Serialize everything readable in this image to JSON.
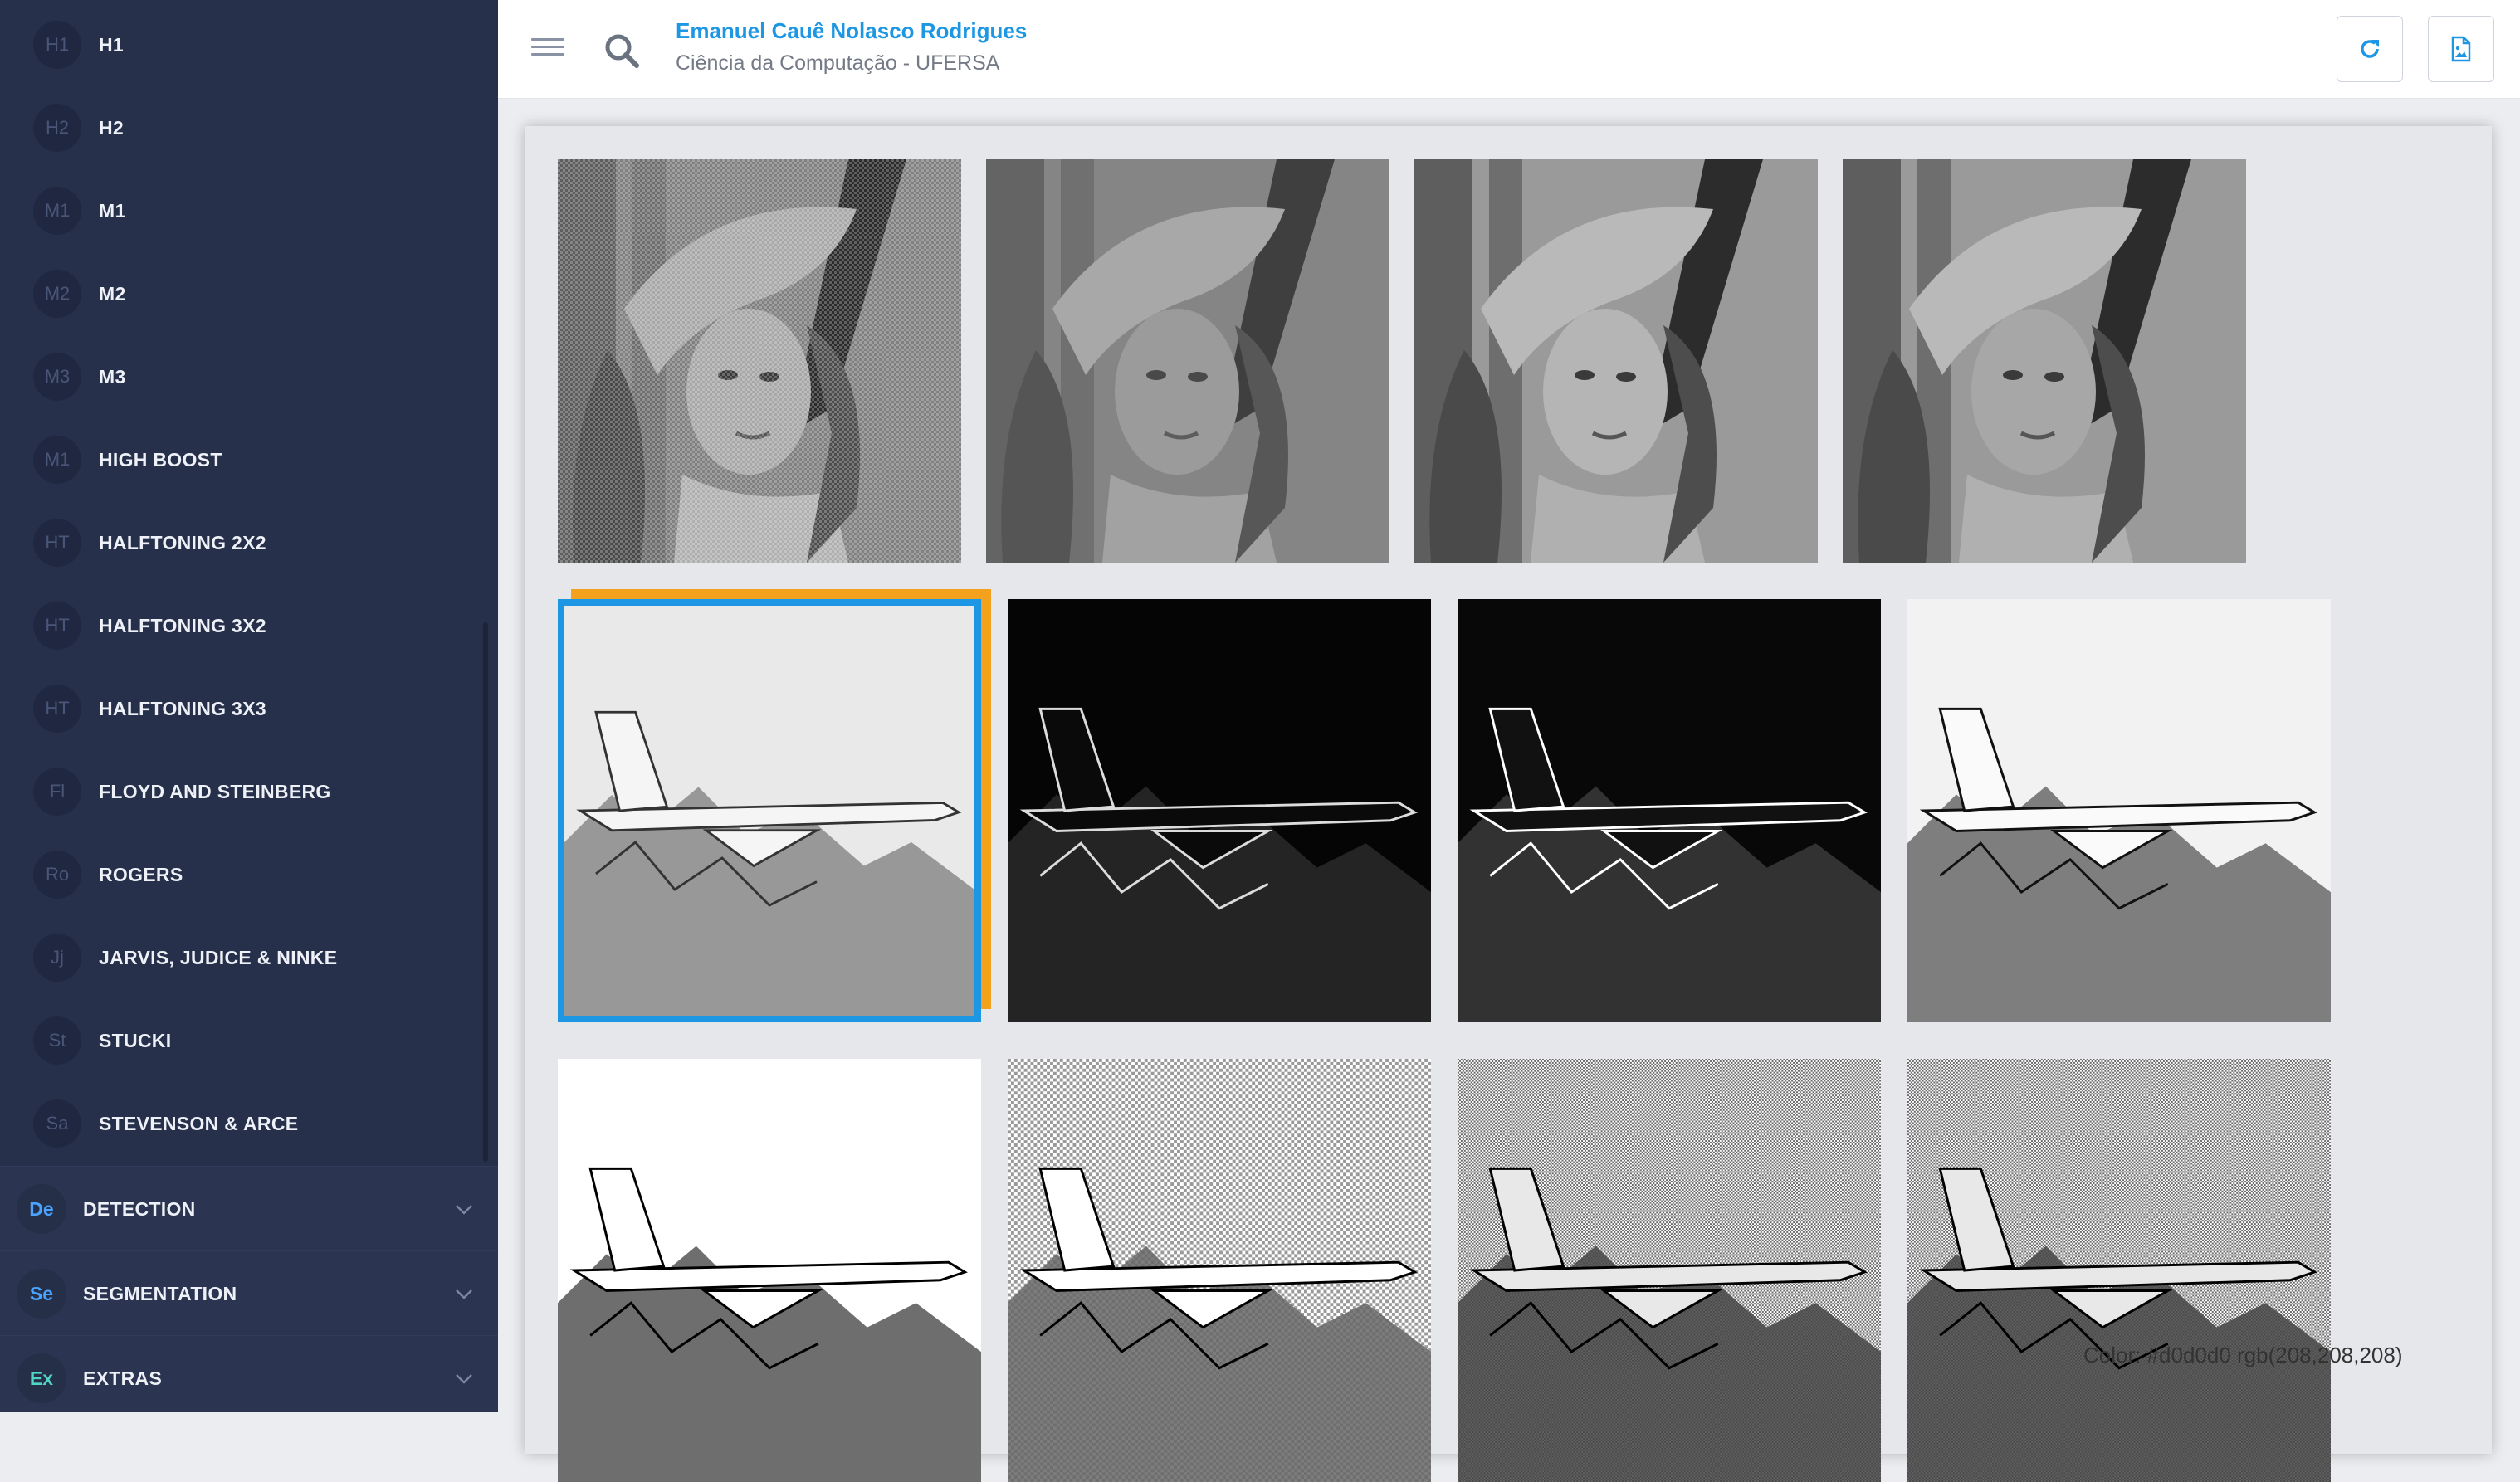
{
  "sidebar": {
    "items": [
      {
        "badge": "H1",
        "label": "H1"
      },
      {
        "badge": "H2",
        "label": "H2"
      },
      {
        "badge": "M1",
        "label": "M1"
      },
      {
        "badge": "M2",
        "label": "M2"
      },
      {
        "badge": "M3",
        "label": "M3"
      },
      {
        "badge": "M1",
        "label": "HIGH BOOST"
      },
      {
        "badge": "HT",
        "label": "HALFTONING 2X2"
      },
      {
        "badge": "HT",
        "label": "HALFTONING 3X2"
      },
      {
        "badge": "HT",
        "label": "HALFTONING 3X3"
      },
      {
        "badge": "Fl",
        "label": "FLOYD AND STEINBERG"
      },
      {
        "badge": "Ro",
        "label": "ROGERS"
      },
      {
        "badge": "Jj",
        "label": "JARVIS, JUDICE & NINKE"
      },
      {
        "badge": "St",
        "label": "STUCKI"
      },
      {
        "badge": "Sa",
        "label": "STEVENSON & ARCE"
      }
    ],
    "groups": [
      {
        "badge": "De",
        "label": "DETECTION",
        "color": "#4aa3ff"
      },
      {
        "badge": "Se",
        "label": "SEGMENTATION",
        "color": "#4aa3ff"
      },
      {
        "badge": "Ex",
        "label": "EXTRAS",
        "color": "#4fd6c4"
      }
    ]
  },
  "header": {
    "user_name": "Emanuel Cauê Nolasco Rodrigues",
    "user_subtitle": "Ciência da Computação - UFERSA",
    "icons": [
      "menu-icon",
      "search-icon",
      "refresh-icon",
      "file-image-icon"
    ],
    "accent": "#1d97e3"
  },
  "gallery": {
    "rows": [
      {
        "subject": "lena",
        "images": [
          "noisy",
          "blurred",
          "filtered",
          "filtered-soft"
        ]
      },
      {
        "subject": "f16",
        "images": [
          "original-selected",
          "edges",
          "edges-strong",
          "high-boost"
        ]
      },
      {
        "subject": "f16",
        "images": [
          "halftoning",
          "halftoning-dither",
          "dither-fine",
          "dither-error-diffusion"
        ]
      }
    ],
    "selection_colors": {
      "primary": "#1d97e3",
      "secondary": "#f4a11e"
    }
  },
  "status_text": "Color: #d0d0d0 rgb(208,208,208)"
}
